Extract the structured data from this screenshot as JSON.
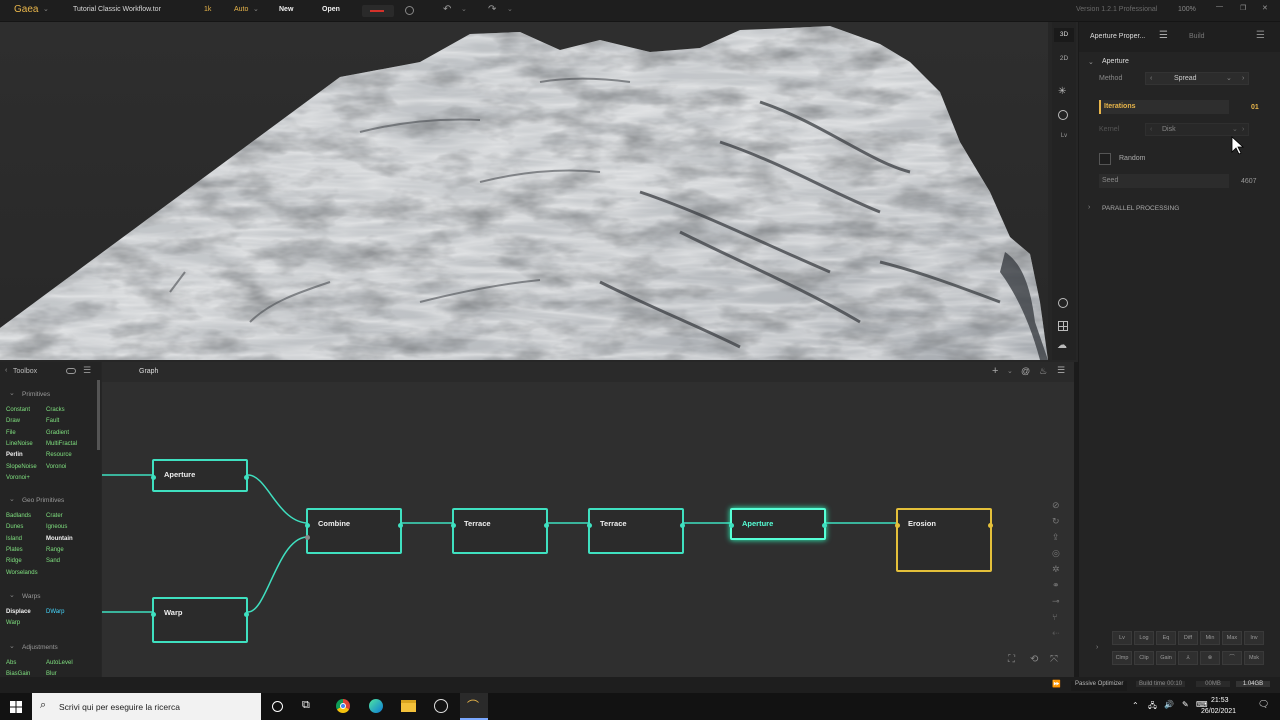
{
  "titlebar": {
    "app": "Gaea",
    "file": "Tutorial Classic Workflow.tor",
    "resolution": "1k",
    "mode": "Auto",
    "new_label": "New",
    "open_label": "Open",
    "version": "Version 1.2.1 Professional",
    "zoom": "100%"
  },
  "viewtools": {
    "btn3d": "3D",
    "btn2d": "2D",
    "lv": "Lv"
  },
  "props": {
    "tab_active": "Aperture Proper...",
    "tab_other": "Build",
    "section": "Aperture",
    "method_label": "Method",
    "method_value": "Spread",
    "iterations_label": "Iterations",
    "iterations_value": "01",
    "kernel_label": "Kernel",
    "kernel_value": "Disk",
    "random_label": "Random",
    "seed_label": "Seed",
    "seed_value": "4607",
    "parallel": "PARALLEL PROCESSING",
    "buttons_row1": [
      "Lv",
      "Log",
      "Eq",
      "Diff",
      "Min",
      "Max",
      "Inv"
    ],
    "buttons_row2": [
      "Clmp",
      "Clip",
      "Gain",
      "⅄",
      "⊗",
      "⌒",
      "Msk"
    ]
  },
  "toolbox": {
    "title": "Toolbox",
    "primitives_title": "Primitives",
    "primitives_col1": [
      "Constant",
      "Draw",
      "File",
      "LineNoise",
      "Perlin",
      "SlopeNoise",
      "Voronoi+"
    ],
    "primitives_col2": [
      "Cracks",
      "Fault",
      "Gradient",
      "MultiFractal",
      "Resource",
      "Voronoi"
    ],
    "geo_title": "Geo Primitives",
    "geo_col1": [
      "Badlands",
      "Dunes",
      "Island",
      "Plates",
      "Ridge",
      "Worselands"
    ],
    "geo_col2": [
      "Crater",
      "Igneous",
      "Mountain",
      "Range",
      "Sand"
    ],
    "warps_title": "Warps",
    "warps_col1": [
      "Displace",
      "Warp"
    ],
    "warps_col2": [
      "DWarp"
    ],
    "adjust_title": "Adjustments",
    "adjust_col1": [
      "Abs",
      "BiasGain"
    ],
    "adjust_col2": [
      "AutoLevel",
      "Blur"
    ]
  },
  "graph": {
    "tab": "Graph",
    "nodes": {
      "aperture1": "Aperture",
      "warp": "Warp",
      "combine": "Combine",
      "terrace1": "Terrace",
      "terrace2": "Terrace",
      "aperture2": "Aperture",
      "erosion": "Erosion"
    }
  },
  "statusbar": {
    "optimizer": "Passive Optimizer",
    "build_time": "Build time 00:10",
    "mem1": "00MB",
    "mem2": "1.04GB"
  },
  "taskbar": {
    "search_placeholder": "Scrivi qui per eseguire la ricerca",
    "time": "21:53",
    "date": "26/02/2021"
  }
}
